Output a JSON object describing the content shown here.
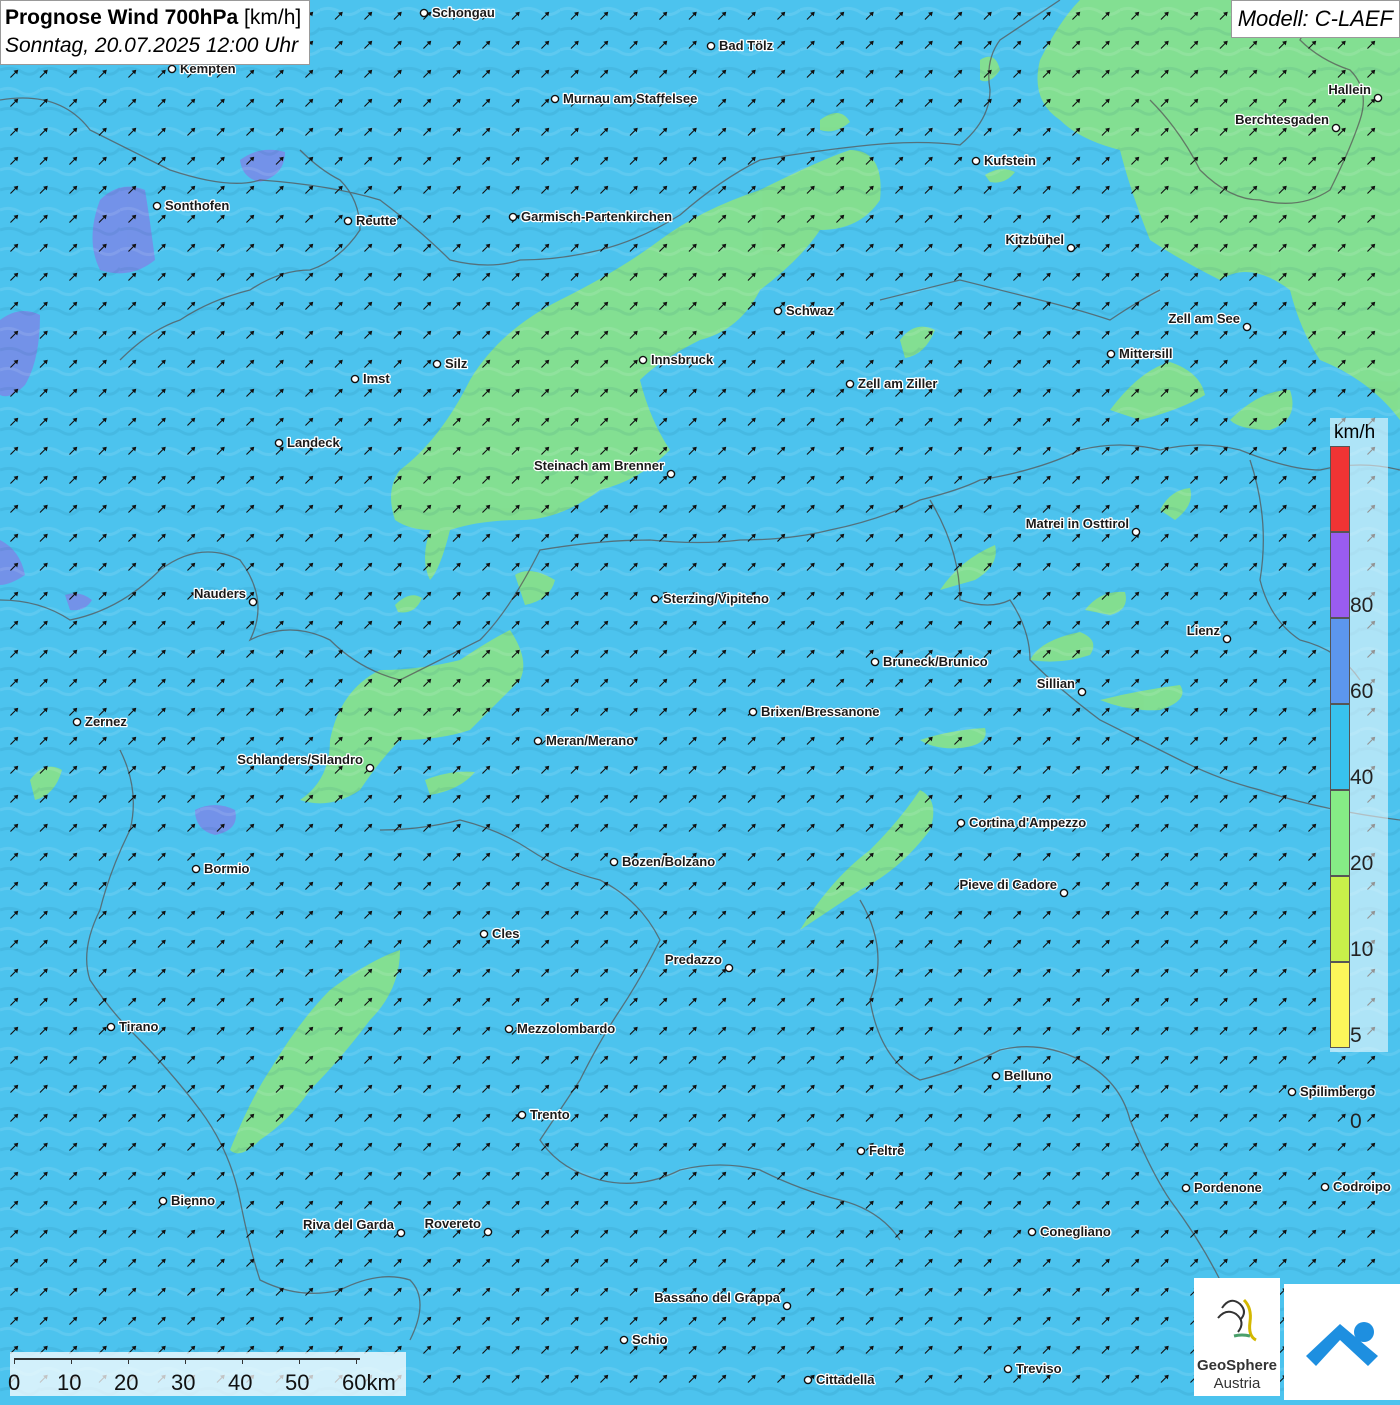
{
  "header": {
    "title_bold": "Prognose Wind 700hPa",
    "title_unit": "[km/h]",
    "datetime": "Sonntag, 20.07.2025 12:00 Uhr",
    "model": "Modell: C-LAEF"
  },
  "legend": {
    "unit": "km/h",
    "classes": [
      {
        "label": "",
        "color": "#f03434"
      },
      {
        "label": "80",
        "color": "#9a5cf0"
      },
      {
        "label": "60",
        "color": "#5c96ee"
      },
      {
        "label": "40",
        "color": "#38c2ee"
      },
      {
        "label": "20",
        "color": "#86ec86"
      },
      {
        "label": "10",
        "color": "#c8f04a"
      },
      {
        "label": "5",
        "color": "#fbf65a"
      },
      {
        "label": "0",
        "color": ""
      }
    ]
  },
  "scalebar": {
    "labels": [
      "0",
      "10",
      "20",
      "30",
      "40",
      "50",
      "60km"
    ]
  },
  "logo": {
    "name_line1": "GeoSphere",
    "name_line2": "Austria"
  },
  "colors": {
    "ocean_base": "#4cc3ee",
    "wind_10_20": "#86e08c",
    "wind_40_60": "#6a80e8",
    "arrow": "#111111",
    "border": "#555555"
  },
  "wind": {
    "direction": "south-west to north-east",
    "dominant_class": "20-40 km/h"
  },
  "cities": [
    "Schongau",
    "Bad Tölz",
    "Kempten",
    "Murnau am Staffelsee",
    "Hallein",
    "Berchtesgaden",
    "Kufstein",
    "Sonthofen",
    "Reutte",
    "Garmisch-Partenkirchen",
    "Kitzbühel",
    "Schwaz",
    "Zell am See",
    "Mittersill",
    "Innsbruck",
    "Silz",
    "Imst",
    "Zell am Ziller",
    "Landeck",
    "Steinach am Brenner",
    "Matrei in Osttirol",
    "Nauders",
    "Sterzing/Vipiteno",
    "Lienz",
    "Bruneck/Brunico",
    "Sillian",
    "Zernez",
    "Brixen/Bressanone",
    "Meran/Merano",
    "Schlanders/Silandro",
    "Cortina d'Ampezzo",
    "Bormio",
    "Bozen/Bolzano",
    "Pieve di Cadore",
    "Cles",
    "Predazzo",
    "Tirano",
    "Mezzolombardo",
    "Belluno",
    "Spilimbergo",
    "Trento",
    "Feltre",
    "Pordenone",
    "Codroipo",
    "Bienno",
    "Riva del Garda",
    "Rovereto",
    "Conegliano",
    "Bassano del Grappa",
    "Schio",
    "Treviso",
    "Cittadella"
  ]
}
